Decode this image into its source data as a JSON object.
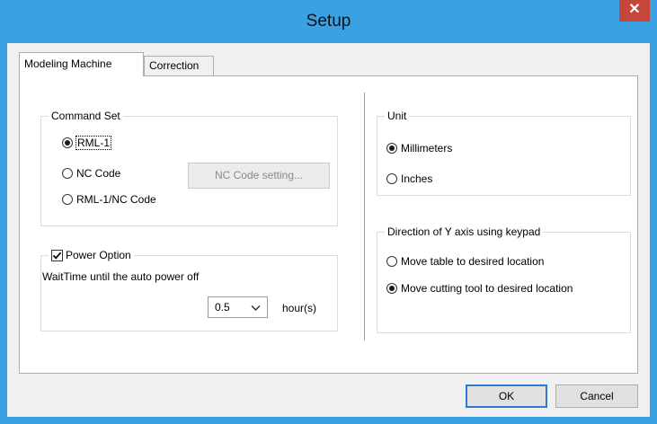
{
  "window": {
    "title": "Setup",
    "close_glyph": "✕"
  },
  "tabs": [
    {
      "label": "Modeling Machine",
      "active": true
    },
    {
      "label": "Correction",
      "active": false
    }
  ],
  "command_set": {
    "title": "Command Set",
    "options": [
      {
        "label": "RML-1",
        "checked": true
      },
      {
        "label": "NC Code",
        "checked": false
      },
      {
        "label": "RML-1/NC Code",
        "checked": false
      }
    ],
    "nc_button_label": "NC Code setting..."
  },
  "power_option": {
    "label": "Power Option",
    "checked": true,
    "wait_label": "WaitTime until the auto power off",
    "value": "0.5",
    "unit": "hour(s)"
  },
  "unit": {
    "title": "Unit",
    "options": [
      {
        "label": "Millimeters",
        "checked": true
      },
      {
        "label": "Inches",
        "checked": false
      }
    ]
  },
  "direction": {
    "title": "Direction of Y axis using keypad",
    "options": [
      {
        "label": "Move table to desired location",
        "checked": false
      },
      {
        "label": "Move cutting tool to desired location",
        "checked": true
      }
    ]
  },
  "footer": {
    "ok_label": "OK",
    "cancel_label": "Cancel"
  }
}
